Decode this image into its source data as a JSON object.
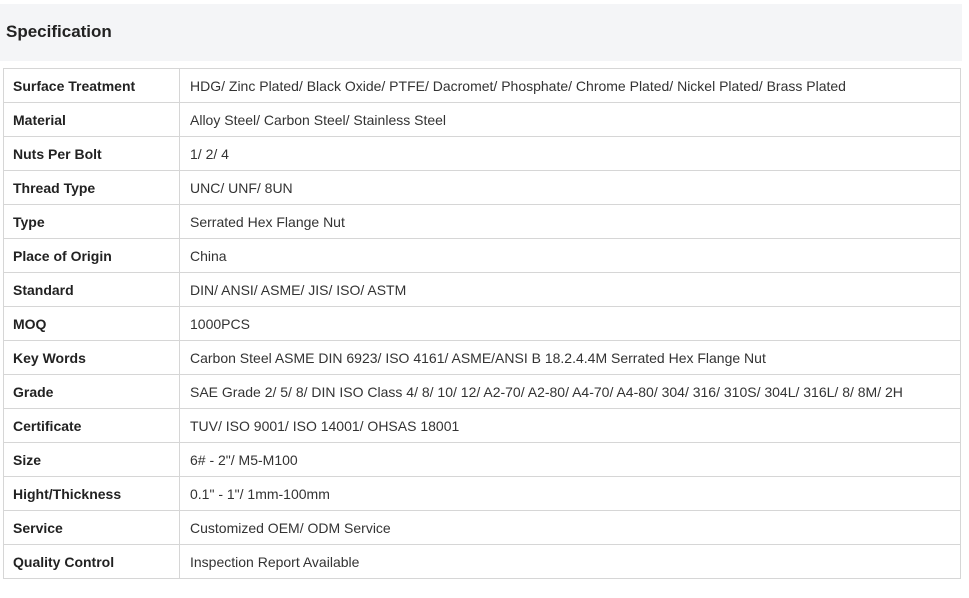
{
  "header": {
    "title": "Specification"
  },
  "rows": [
    {
      "label": "Surface Treatment",
      "value": "HDG/ Zinc Plated/ Black Oxide/ PTFE/ Dacromet/ Phosphate/ Chrome Plated/ Nickel Plated/ Brass Plated"
    },
    {
      "label": "Material",
      "value": "Alloy Steel/ Carbon Steel/ Stainless Steel"
    },
    {
      "label": "Nuts Per Bolt",
      "value": "1/ 2/ 4"
    },
    {
      "label": "Thread Type",
      "value": "UNC/ UNF/ 8UN"
    },
    {
      "label": "Type",
      "value": "Serrated Hex Flange Nut"
    },
    {
      "label": "Place of Origin",
      "value": "China"
    },
    {
      "label": "Standard",
      "value": "DIN/ ANSI/ ASME/ JIS/ ISO/ ASTM"
    },
    {
      "label": "MOQ",
      "value": "1000PCS"
    },
    {
      "label": "Key Words",
      "value": "Carbon Steel ASME DIN 6923/ ISO 4161/ ASME/ANSI B 18.2.4.4M Serrated Hex Flange Nut"
    },
    {
      "label": "Grade",
      "value": "SAE Grade 2/ 5/ 8/ DIN ISO Class 4/ 8/ 10/ 12/ A2-70/ A2-80/ A4-70/ A4-80/ 304/ 316/ 310S/ 304L/ 316L/ 8/ 8M/ 2H"
    },
    {
      "label": "Certificate",
      "value": "TUV/ ISO 9001/ ISO 14001/ OHSAS 18001"
    },
    {
      "label": "Size",
      "value": "6# - 2\"/ M5-M100"
    },
    {
      "label": "Hight/Thickness",
      "value": "0.1\" - 1\"/ 1mm-100mm"
    },
    {
      "label": "Service",
      "value": "Customized OEM/ ODM Service"
    },
    {
      "label": "Quality Control",
      "value": "Inspection Report Available"
    }
  ]
}
